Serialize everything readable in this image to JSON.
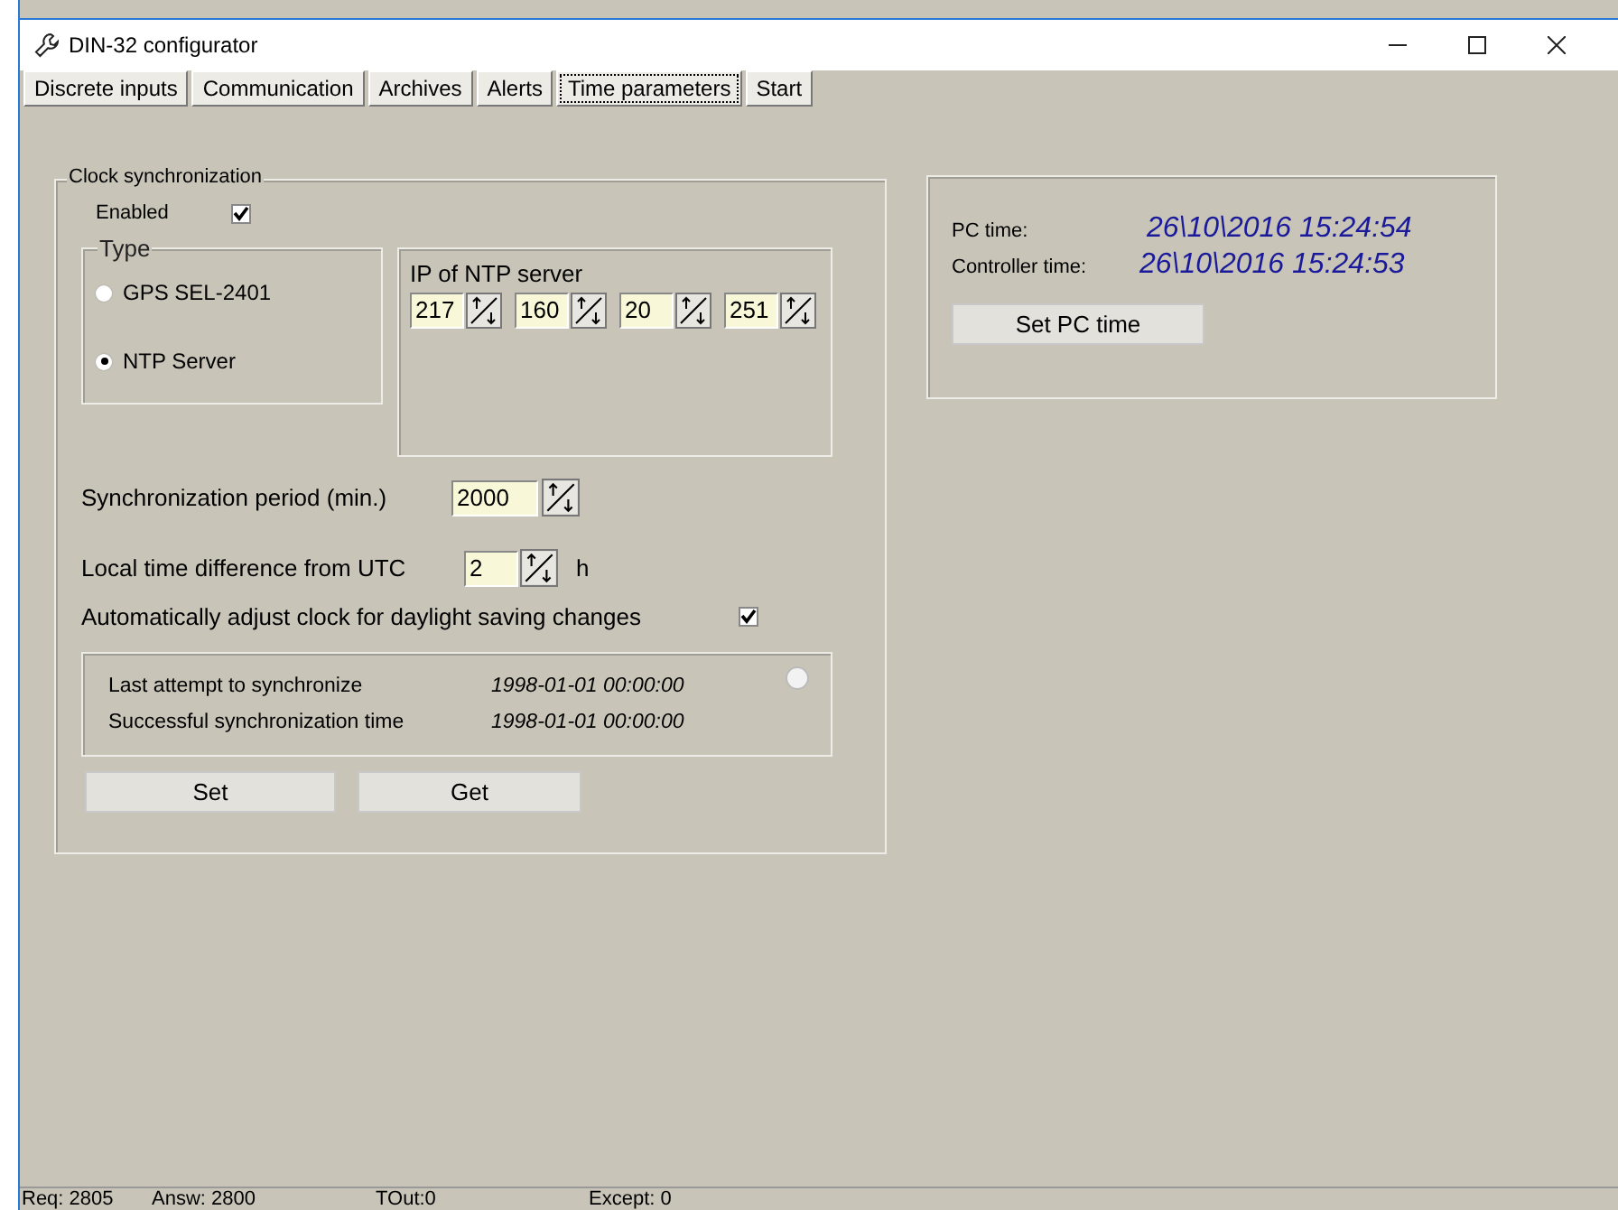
{
  "window": {
    "title": "DIN-32 configurator"
  },
  "tabs": [
    {
      "label": "Discrete inputs",
      "selected": false
    },
    {
      "label": "Communication",
      "selected": false
    },
    {
      "label": "Archives",
      "selected": false
    },
    {
      "label": "Alerts",
      "selected": false
    },
    {
      "label": "Time parameters",
      "selected": true
    },
    {
      "label": "Start",
      "selected": false
    }
  ],
  "clock_sync": {
    "title": "Clock synchronization",
    "enabled": {
      "label": "Enabled",
      "checked": true
    },
    "type": {
      "title": "Type",
      "options": [
        {
          "label": "GPS SEL-2401",
          "selected": false
        },
        {
          "label": "NTP Server",
          "selected": true
        }
      ]
    },
    "ntp": {
      "title": "IP of NTP server",
      "octets": [
        "217",
        "160",
        "20",
        "251"
      ]
    },
    "period": {
      "label": "Synchronization period (min.)",
      "value": "2000"
    },
    "utc_offset": {
      "label": "Local time difference from UTC",
      "value": "2",
      "unit": "h"
    },
    "dst": {
      "label": "Automatically adjust clock for daylight saving changes",
      "checked": true
    },
    "status": {
      "rows": [
        {
          "label": "Last attempt to synchronize",
          "value": "1998-01-01 00:00:00"
        },
        {
          "label": "Successful synchronization time",
          "value": "1998-01-01 00:00:00"
        }
      ]
    },
    "buttons": [
      "Set",
      "Get"
    ]
  },
  "clock": {
    "rows": [
      {
        "label": "PC time:",
        "value": "26\\10\\2016 15:24:54"
      },
      {
        "label": "Controller time:",
        "value": "26\\10\\2016 15:24:53"
      }
    ],
    "button": "Set PC time"
  },
  "status_bar": [
    "Req: 2805",
    "Answ: 2800",
    "TOut:0",
    "Except:  0"
  ]
}
